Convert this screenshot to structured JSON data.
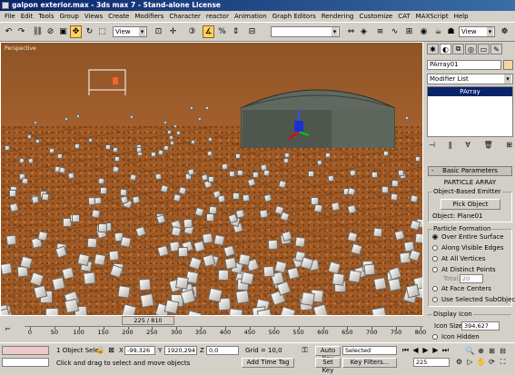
{
  "window": {
    "title": "galpon exterior.max - 3ds max 7 - Stand-alone License"
  },
  "menu": [
    "File",
    "Edit",
    "Tools",
    "Group",
    "Views",
    "Create",
    "Modifiers",
    "Character",
    "reactor",
    "Animation",
    "Graph Editors",
    "Rendering",
    "Customize",
    "CAT",
    "MAXScript",
    "Help"
  ],
  "toolbar": {
    "coord_system": "View",
    "named_selection": "",
    "view_dropdown": "View"
  },
  "viewport": {
    "label": "Perspective"
  },
  "command_panel": {
    "object_name": "PArray01",
    "modifier_list": "Modifier List",
    "stack_item": "PArray",
    "rollout_title": "Basic Parameters",
    "section_title": "PARTICLE ARRAY",
    "emitter_group": "Object-Based Emitter",
    "pick_button": "Pick Object",
    "object_label": "Object: Plane01",
    "formation_group": "Particle Formation",
    "formation_options": [
      "Over Entire Surface",
      "Along Visible Edges",
      "At All Vertices",
      "At Distinct Points",
      "At Face Centers"
    ],
    "selected_option": "Over Entire Surface",
    "total_label": "Total:",
    "total_value": "20",
    "use_subobjects": "Use Selected SubObjects",
    "display_group": "Display Icon",
    "icon_size_label": "Icon Size:",
    "icon_size_value": "394,627",
    "icon_hidden": "Icon Hidden"
  },
  "timeline": {
    "frame": "225 / 810",
    "ticks": [
      "0",
      "50",
      "100",
      "150",
      "200",
      "250",
      "300",
      "350",
      "400",
      "450",
      "500",
      "550",
      "600",
      "650",
      "700",
      "750",
      "800"
    ]
  },
  "status": {
    "selection": "1 Object Sele",
    "prompt": "Click and drag to select and move objects",
    "x": "-99,326",
    "y": "1920,294",
    "z": "0,0",
    "grid": "Grid = 10,0",
    "add_time_tag": "Add Time Tag",
    "auto_key": "Auto Key",
    "set_key": "Set Key",
    "key_mode": "Selected",
    "key_filters": "Key Filters...",
    "current_frame": "225"
  }
}
